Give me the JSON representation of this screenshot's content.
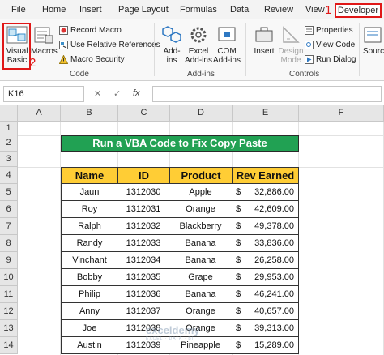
{
  "ribbon_tabs": [
    "File",
    "Home",
    "Insert",
    "Page Layout",
    "Formulas",
    "Data",
    "Review",
    "View"
  ],
  "developer_tab": "Developer",
  "callouts": {
    "one": "1",
    "two": "2"
  },
  "groups": {
    "code": {
      "label": "Code",
      "visual_basic_line1": "Visual",
      "visual_basic_line2": "Basic",
      "macros": "Macros",
      "record_macro": "Record Macro",
      "relative_refs": "Use Relative References",
      "macro_security": "Macro Security"
    },
    "addins": {
      "label": "Add-ins",
      "addins_line1": "Add-",
      "addins_line2": "ins",
      "excel_line1": "Excel",
      "excel_line2": "Add-ins",
      "com_line1": "COM",
      "com_line2": "Add-ins"
    },
    "controls": {
      "label": "Controls",
      "insert": "Insert",
      "design_line1": "Design",
      "design_line2": "Mode",
      "properties": "Properties",
      "view_code": "View Code",
      "run_dialog": "Run Dialog"
    },
    "xml": {
      "source": "Sourc"
    }
  },
  "formula_bar": {
    "name_box": "K16",
    "cancel": "✕",
    "enter": "✓",
    "fx": "fx"
  },
  "columns": [
    "A",
    "B",
    "C",
    "D",
    "E",
    "F"
  ],
  "rows": [
    "1",
    "2",
    "3",
    "4",
    "5",
    "6",
    "7",
    "8",
    "9",
    "10",
    "11",
    "12",
    "13",
    "14"
  ],
  "sheet": {
    "title": "Run a VBA Code to Fix Copy Paste",
    "headers": [
      "Name",
      "ID",
      "Product",
      "Rev Earned"
    ],
    "currency": "$",
    "rows": [
      {
        "name": "Jaun",
        "id": "1312030",
        "product": "Apple",
        "rev": "32,886.00"
      },
      {
        "name": "Roy",
        "id": "1312031",
        "product": "Orange",
        "rev": "42,609.00"
      },
      {
        "name": "Ralph",
        "id": "1312032",
        "product": "Blackberry",
        "rev": "49,378.00"
      },
      {
        "name": "Randy",
        "id": "1312033",
        "product": "Banana",
        "rev": "33,836.00"
      },
      {
        "name": "Vinchant",
        "id": "1312034",
        "product": "Banana",
        "rev": "26,258.00"
      },
      {
        "name": "Bobby",
        "id": "1312035",
        "product": "Grape",
        "rev": "29,953.00"
      },
      {
        "name": "Philip",
        "id": "1312036",
        "product": "Banana",
        "rev": "46,241.00"
      },
      {
        "name": "Anny",
        "id": "1312037",
        "product": "Orange",
        "rev": "40,657.00"
      },
      {
        "name": "Joe",
        "id": "1312038",
        "product": "Orange",
        "rev": "39,313.00"
      },
      {
        "name": "Austin",
        "id": "1312039",
        "product": "Pineapple",
        "rev": "15,289.00"
      }
    ]
  },
  "watermark": {
    "main": "exceldemy",
    "sub": "EXCEL · DATA · BI"
  }
}
